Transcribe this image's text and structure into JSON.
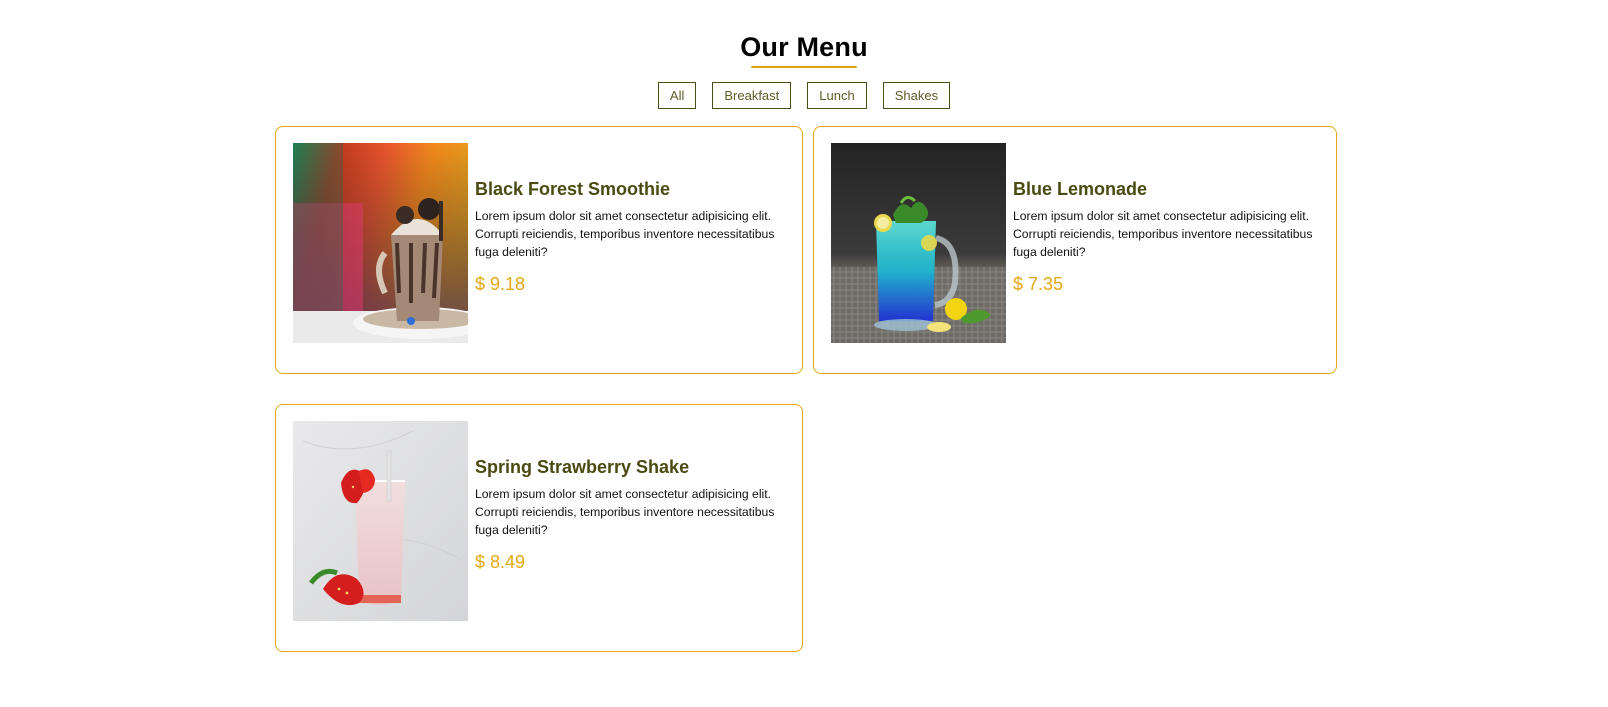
{
  "header": {
    "title": "Our Menu"
  },
  "filters": [
    "All",
    "Breakfast",
    "Lunch",
    "Shakes"
  ],
  "items": [
    {
      "name": "Black Forest Smoothie",
      "description": "Lorem ipsum dolor sit amet consectetur adipisicing elit. Corrupti reiciendis, temporibus inventore necessitatibus fuga deleniti?",
      "price": "$ 9.18",
      "image": "black-forest-smoothie-photo"
    },
    {
      "name": "Blue Lemonade",
      "description": "Lorem ipsum dolor sit amet consectetur adipisicing elit. Corrupti reiciendis, temporibus inventore necessitatibus fuga deleniti?",
      "price": "$ 7.35",
      "image": "blue-lemonade-photo"
    },
    {
      "name": "Spring Strawberry Shake",
      "description": "Lorem ipsum dolor sit amet consectetur adipisicing elit. Corrupti reiciendis, temporibus inventore necessitatibus fuga deleniti?",
      "price": "$ 8.49",
      "image": "strawberry-shake-photo"
    }
  ],
  "colors": {
    "accent": "#e3a812",
    "title_text": "#4b4a12",
    "filter_border": "#4a4d16"
  }
}
